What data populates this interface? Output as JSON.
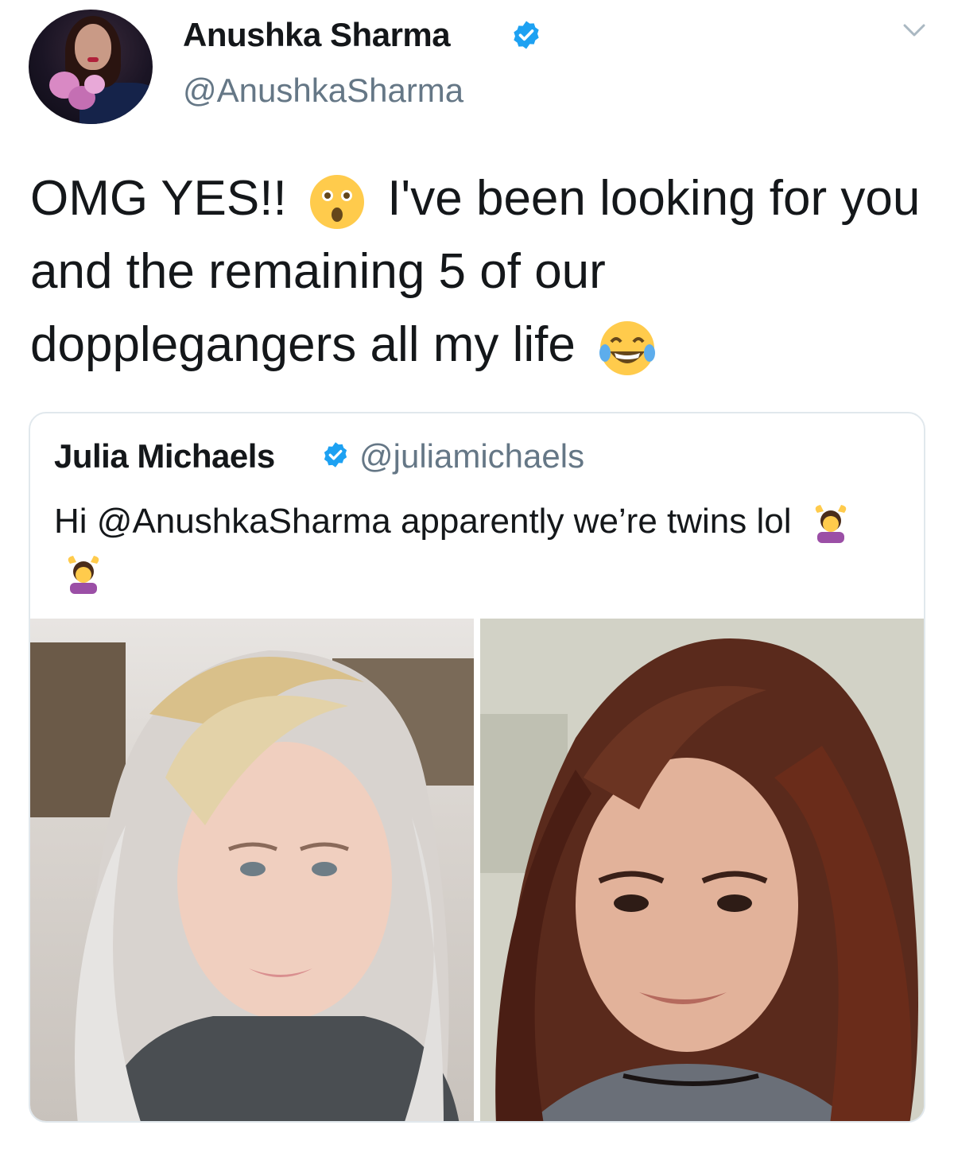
{
  "tweet": {
    "author_name": "Anushka Sharma",
    "author_handle": "@AnushkaSharma",
    "verified": true,
    "text_part1": "OMG YES!!",
    "text_part2": "I've been looking for you and the remaining 5 of our dopplegangers all my life",
    "emoji_1": "hushed-face-emoji",
    "emoji_2": "face-with-tears-of-joy-emoji"
  },
  "quoted_tweet": {
    "author_name": "Julia Michaels",
    "author_handle": "@juliamichaels",
    "verified": true,
    "text": "Hi @AnushkaSharma apparently we’re twins lol",
    "emojis": [
      "woman-gesturing-ok-emoji",
      "woman-gesturing-ok-emoji"
    ],
    "images": [
      "blonde-woman-selfie",
      "brunette-woman-selfie"
    ]
  },
  "colors": {
    "text": "#14171a",
    "secondary": "#657786",
    "verified_blue": "#1da1f2",
    "border": "#e1e8ed"
  }
}
